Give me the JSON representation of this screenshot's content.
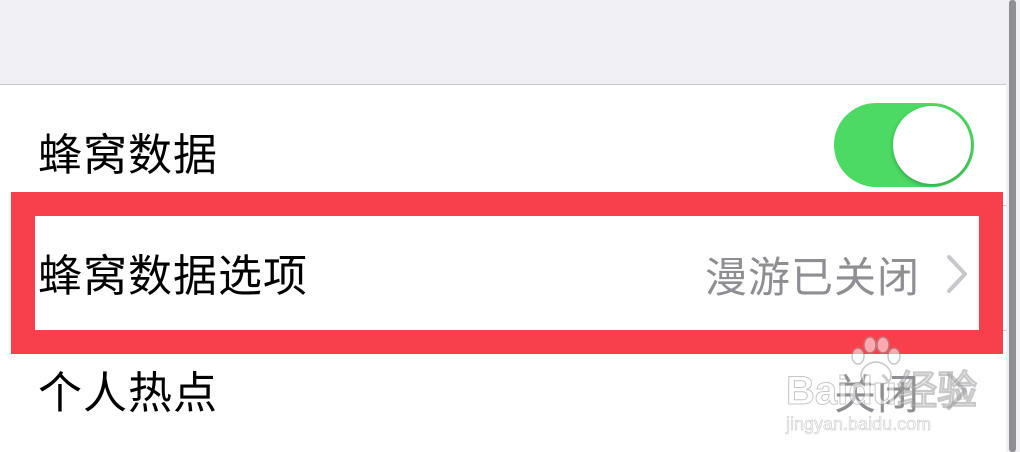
{
  "settings": {
    "cellular_data": {
      "label": "蜂窝数据",
      "toggle_on": true
    },
    "cellular_data_options": {
      "label": "蜂窝数据选项",
      "value": "漫游已关闭"
    },
    "personal_hotspot": {
      "label": "个人热点",
      "value": "关闭"
    }
  },
  "watermark": {
    "main": "Baidu经验",
    "sub": "jingyan.baidu.com"
  },
  "colors": {
    "toggle_on": "#4cd964",
    "highlight": "#f8404c",
    "secondary_text": "#8e8e93",
    "background": "#efeff4"
  },
  "icons": {
    "chevron": "chevron-right-icon",
    "watermark_logo": "baidu-paw-icon"
  }
}
